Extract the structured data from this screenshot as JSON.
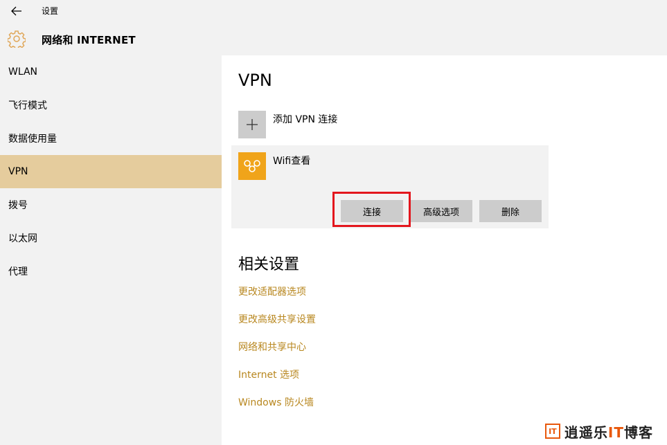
{
  "titlebar": {
    "app_title": "设置"
  },
  "header": {
    "section_title": "网络和 INTERNET"
  },
  "sidebar": {
    "items": [
      {
        "label": "WLAN"
      },
      {
        "label": "飞行模式"
      },
      {
        "label": "数据使用量"
      },
      {
        "label": "VPN"
      },
      {
        "label": "拨号"
      },
      {
        "label": "以太网"
      },
      {
        "label": "代理"
      }
    ],
    "active_index": 3
  },
  "main": {
    "page_title": "VPN",
    "add_vpn_label": "添加 VPN 连接",
    "vpn_entry": {
      "name": "Wifi查看",
      "buttons": {
        "connect": "连接",
        "advanced": "高级选项",
        "delete": "删除"
      }
    },
    "related": {
      "title": "相关设置",
      "links": [
        "更改适配器选项",
        "更改高级共享设置",
        "网络和共享中心",
        "Internet 选项",
        "Windows 防火墙"
      ]
    }
  },
  "watermark": {
    "logo": "IT",
    "text_a": "逍遥乐",
    "text_b": "IT",
    "text_c": "博客"
  },
  "colors": {
    "accent": "#e5cc9d",
    "link": "#b8871f",
    "vpn_icon_bg": "#f0a41a",
    "highlight": "#e3161d"
  }
}
